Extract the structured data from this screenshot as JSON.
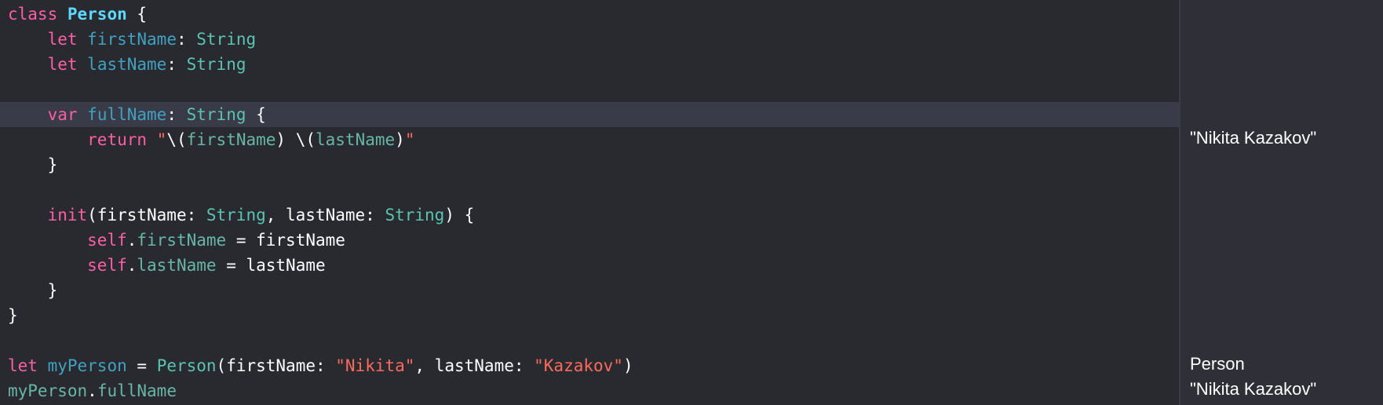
{
  "editor": {
    "highlight_color": "#393b49",
    "lines": [
      [
        {
          "t": "class",
          "c": "kw"
        },
        {
          "t": " ",
          "c": "plain"
        },
        {
          "t": "Person",
          "c": "cls-decl"
        },
        {
          "t": " {",
          "c": "plain"
        }
      ],
      [
        {
          "t": "    ",
          "c": "plain"
        },
        {
          "t": "let",
          "c": "kw"
        },
        {
          "t": " ",
          "c": "plain"
        },
        {
          "t": "firstName",
          "c": "prop-decl"
        },
        {
          "t": ": ",
          "c": "plain"
        },
        {
          "t": "String",
          "c": "type"
        }
      ],
      [
        {
          "t": "    ",
          "c": "plain"
        },
        {
          "t": "let",
          "c": "kw"
        },
        {
          "t": " ",
          "c": "plain"
        },
        {
          "t": "lastName",
          "c": "prop-decl"
        },
        {
          "t": ": ",
          "c": "plain"
        },
        {
          "t": "String",
          "c": "type"
        }
      ],
      [],
      [
        {
          "t": "    ",
          "c": "plain"
        },
        {
          "t": "var",
          "c": "kw"
        },
        {
          "t": " ",
          "c": "plain"
        },
        {
          "t": "fullName",
          "c": "prop-decl"
        },
        {
          "t": ": ",
          "c": "plain"
        },
        {
          "t": "String",
          "c": "type"
        },
        {
          "t": " {",
          "c": "plain"
        }
      ],
      [
        {
          "t": "        ",
          "c": "plain"
        },
        {
          "t": "return",
          "c": "kw"
        },
        {
          "t": " ",
          "c": "plain"
        },
        {
          "t": "\"",
          "c": "str"
        },
        {
          "t": "\\(",
          "c": "plain"
        },
        {
          "t": "firstName",
          "c": "prop"
        },
        {
          "t": ") \\(",
          "c": "plain"
        },
        {
          "t": "lastName",
          "c": "prop"
        },
        {
          "t": ")",
          "c": "plain"
        },
        {
          "t": "\"",
          "c": "str"
        }
      ],
      [
        {
          "t": "    }",
          "c": "plain"
        }
      ],
      [],
      [
        {
          "t": "    ",
          "c": "plain"
        },
        {
          "t": "init",
          "c": "kw"
        },
        {
          "t": "(firstName: ",
          "c": "plain"
        },
        {
          "t": "String",
          "c": "type"
        },
        {
          "t": ", lastName: ",
          "c": "plain"
        },
        {
          "t": "String",
          "c": "type"
        },
        {
          "t": ") {",
          "c": "plain"
        }
      ],
      [
        {
          "t": "        ",
          "c": "plain"
        },
        {
          "t": "self",
          "c": "kw"
        },
        {
          "t": ".",
          "c": "plain"
        },
        {
          "t": "firstName",
          "c": "prop"
        },
        {
          "t": " = firstName",
          "c": "plain"
        }
      ],
      [
        {
          "t": "        ",
          "c": "plain"
        },
        {
          "t": "self",
          "c": "kw"
        },
        {
          "t": ".",
          "c": "plain"
        },
        {
          "t": "lastName",
          "c": "prop"
        },
        {
          "t": " = lastName",
          "c": "plain"
        }
      ],
      [
        {
          "t": "    }",
          "c": "plain"
        }
      ],
      [
        {
          "t": "}",
          "c": "plain"
        }
      ],
      [],
      [
        {
          "t": "let",
          "c": "kw"
        },
        {
          "t": " ",
          "c": "plain"
        },
        {
          "t": "myPerson",
          "c": "prop-decl"
        },
        {
          "t": " = ",
          "c": "plain"
        },
        {
          "t": "Person",
          "c": "type"
        },
        {
          "t": "(firstName: ",
          "c": "plain"
        },
        {
          "t": "\"Nikita\"",
          "c": "str"
        },
        {
          "t": ", lastName: ",
          "c": "plain"
        },
        {
          "t": "\"Kazakov\"",
          "c": "str"
        },
        {
          "t": ")",
          "c": "plain"
        }
      ],
      [
        {
          "t": "myPerson",
          "c": "prop"
        },
        {
          "t": ".",
          "c": "plain"
        },
        {
          "t": "fullName",
          "c": "prop"
        }
      ]
    ]
  },
  "results": {
    "fullname_getter": "\"Nikita Kazakov\"",
    "myperson_instance": "Person",
    "myperson_fullname": "\"Nikita Kazakov\""
  }
}
